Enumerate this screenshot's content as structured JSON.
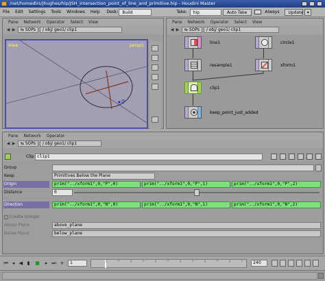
{
  "window": {
    "title": "/net/homedirs/jhughes/hip/JSH_intersection_point_of_line_and_primitive.hip - Houdini Master"
  },
  "menubar": {
    "items": [
      "File",
      "Edit",
      "Settings",
      "Tools",
      "Windows",
      "Help"
    ],
    "desk_label": "Desk:",
    "desk_value": "Build",
    "take_label": "Take:",
    "take_value": "hip",
    "auto_take": "Auto Take",
    "always": "Always",
    "update": "Update"
  },
  "viewer": {
    "menu": [
      "Pane",
      "Network",
      "Operator",
      "Select",
      "View"
    ],
    "sop_tab": "SOPs",
    "path": "/ obj/ geo1/ clip1",
    "view_label": "View",
    "camera": "persp1",
    "point_label": "0"
  },
  "network": {
    "menu": [
      "Pane",
      "Network",
      "Operator",
      "Select",
      "View"
    ],
    "sop_tab": "SOPs",
    "path": "/ obj/ geo1/ clip1",
    "nodes": {
      "line1": "line1",
      "circle1": "circle1",
      "resample1": "resample1",
      "xform1": "xform1",
      "clip1": "clip1",
      "keep": "keep_point_just_added"
    }
  },
  "params": {
    "menu": [
      "Pane",
      "Network",
      "Operator"
    ],
    "sop_tab": "SOPs",
    "path": "/ obj/ geo1/ clip1",
    "clip_label": "Clip",
    "clip_name": "clip1",
    "group_label": "Group",
    "group_value": "",
    "keep_label": "Keep",
    "keep_value": "Primitives Below the Plane",
    "origin_label": "Origin",
    "origin": [
      "prim(\"../xform1\",0,\"P\",0)",
      "prim(\"../xform1\",0,\"P\",1)",
      "prim(\"../xform1\",0,\"P\",2)"
    ],
    "distance_label": "Distance",
    "distance_value": "0",
    "direction_label": "Direction",
    "direction": [
      "prim(\"../xform1\",0,\"N\",0)",
      "prim(\"../xform1\",0,\"N\",1)",
      "prim(\"../xform1\",0,\"N\",2)"
    ],
    "create_groups": "Create Groups",
    "above_label": "Above Plane",
    "above_value": "above_plane",
    "below_label": "Below Plane",
    "below_value": "below_plane"
  },
  "timeline": {
    "frame": "1",
    "start": "1",
    "end": "240",
    "ticks": [
      "1",
      "24",
      "48",
      "72",
      "96",
      "120",
      "144",
      "168",
      "192",
      "216",
      "240"
    ]
  },
  "colors": {
    "viewport_bg": "#a39eb4",
    "viewport_border": "#4b4ea1",
    "expr_green": "#7ee07b",
    "param_highlight": "#7a6fa5",
    "point_blue": "#1b2fd0",
    "line_brown": "#7a3a22"
  }
}
